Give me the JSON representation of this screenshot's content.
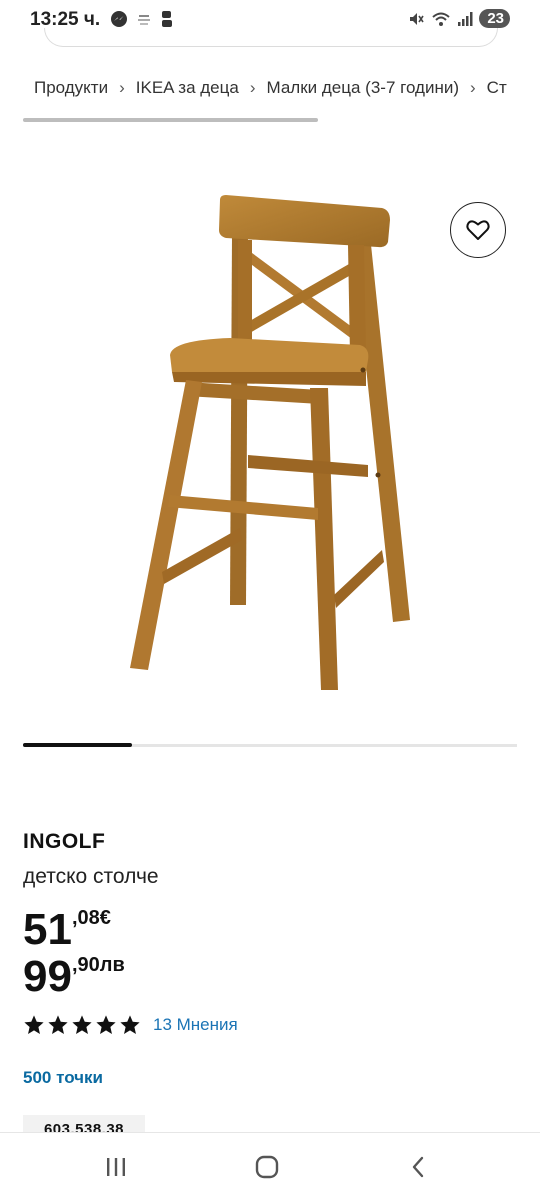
{
  "status_bar": {
    "time": "13:25 ч.",
    "battery": "23"
  },
  "breadcrumb": {
    "items": [
      "Продукти",
      "IKEA за деца",
      "Малки деца (3-7 години)",
      "Ст"
    ],
    "separator": "›"
  },
  "product": {
    "name": "INGOLF",
    "description": "детско столче",
    "price_eur": {
      "integer": "51",
      "decimal": ",08€"
    },
    "price_bgn": {
      "integer": "99",
      "decimal": ",90лв"
    },
    "rating": 5,
    "reviews": "13 Мнения",
    "points": "500 точки",
    "article_number": "603.538.38"
  },
  "image_carousel": {
    "position": 0.22
  },
  "icons": {
    "favorite": "heart-outline-icon",
    "star": "star-filled-icon",
    "nav_recent": "recent-apps-icon",
    "nav_home": "home-icon",
    "nav_back": "back-icon"
  },
  "colors": {
    "link": "#1b74b5",
    "points": "#0a6aa1",
    "wood": "#b7812f"
  }
}
